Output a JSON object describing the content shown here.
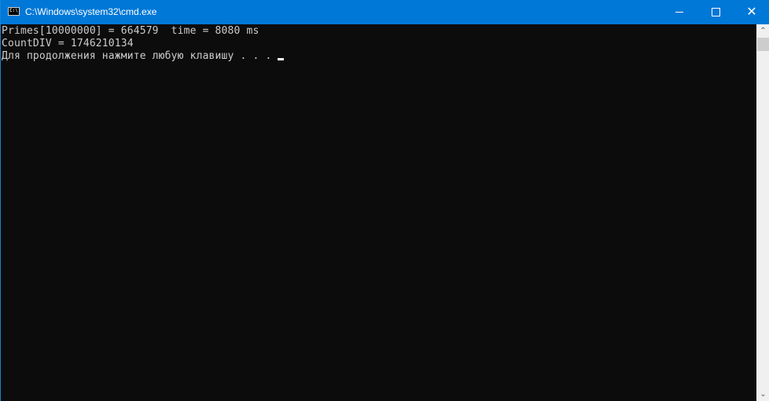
{
  "window": {
    "title": "C:\\Windows\\system32\\cmd.exe",
    "icon_text": "C:\\"
  },
  "controls": {
    "minimize": "minimize-icon",
    "maximize": "maximize-icon",
    "close": "✕"
  },
  "console": {
    "lines": [
      "Primes[10000000] = 664579  time = 8080 ms",
      "CountDIV = 1746210134",
      "Для продолжения нажмите любую клавишу . . ."
    ]
  },
  "scrollbar": {
    "up": "⌃",
    "down": "⌄"
  },
  "colors": {
    "titlebar": "#0078d7",
    "console_bg": "#0c0c0c",
    "console_fg": "#cccccc"
  }
}
